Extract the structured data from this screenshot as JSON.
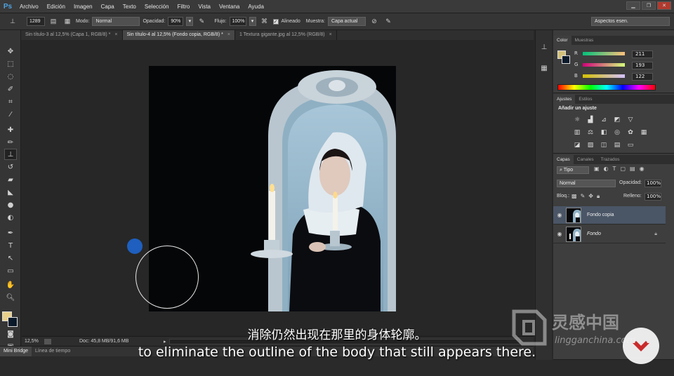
{
  "app": {
    "logo": "Ps"
  },
  "menubar": {
    "items": [
      "Archivo",
      "Edición",
      "Imagen",
      "Capa",
      "Texto",
      "Selección",
      "Filtro",
      "Vista",
      "Ventana",
      "Ayuda"
    ]
  },
  "window_controls": [
    "minimize-icon",
    "restore-icon",
    "close-icon"
  ],
  "options": {
    "brush_size": "1289",
    "mode_label": "Modo:",
    "mode_value": "Normal",
    "opacity_label": "Opacidad:",
    "opacity_value": "90%",
    "flow_label": "Flujo:",
    "flow_value": "100%",
    "aligned_label": "Alineado",
    "aligned_checked": true,
    "sample_label": "Muestra:",
    "sample_value": "Capa actual",
    "workspace": "Aspectos esen."
  },
  "doc_tabs": [
    {
      "label": "Sin título-3 al 12,5% (Capa 1, RGB/8) *",
      "active": false
    },
    {
      "label": "Sin título-4 al 12,5% (Fondo copia, RGB/8) *",
      "active": true
    },
    {
      "label": "1 Textura gigante.jpg al 12,5% (RGB/8)",
      "active": false
    }
  ],
  "status": {
    "zoom": "12,5%",
    "doc": "Doc: 45,8 MB/91,6 MB"
  },
  "bottom_tabs": [
    "Mini Bridge",
    "Línea de tiempo"
  ],
  "color_panel": {
    "tabs": [
      "Color",
      "Muestras"
    ],
    "r": 211,
    "g": 193,
    "b": 122,
    "foreground": "#d3c17a",
    "background": "#0a1a2a"
  },
  "adjustments_panel": {
    "tabs": [
      "Ajustes",
      "Estilos"
    ],
    "title": "Añadir un ajuste"
  },
  "layers_panel": {
    "tabs": [
      "Capas",
      "Canales",
      "Trazados"
    ],
    "filter_label": "Tipo",
    "blend_mode": "Normal",
    "opacity_label": "Opacidad:",
    "opacity_value": "100%",
    "lock_label": "Bloq.:",
    "fill_label": "Relleno:",
    "fill_value": "100%",
    "layers": [
      {
        "name": "Fondo copia",
        "selected": true,
        "locked": false
      },
      {
        "name": "Fondo",
        "selected": false,
        "locked": true
      }
    ]
  },
  "subtitles": {
    "cn": "消除仍然出现在那里的身体轮廓。",
    "en": "to eliminate the outline of the body that still appears there."
  },
  "watermark": {
    "cn": "灵感中国",
    "url": "lingganchina.com"
  }
}
